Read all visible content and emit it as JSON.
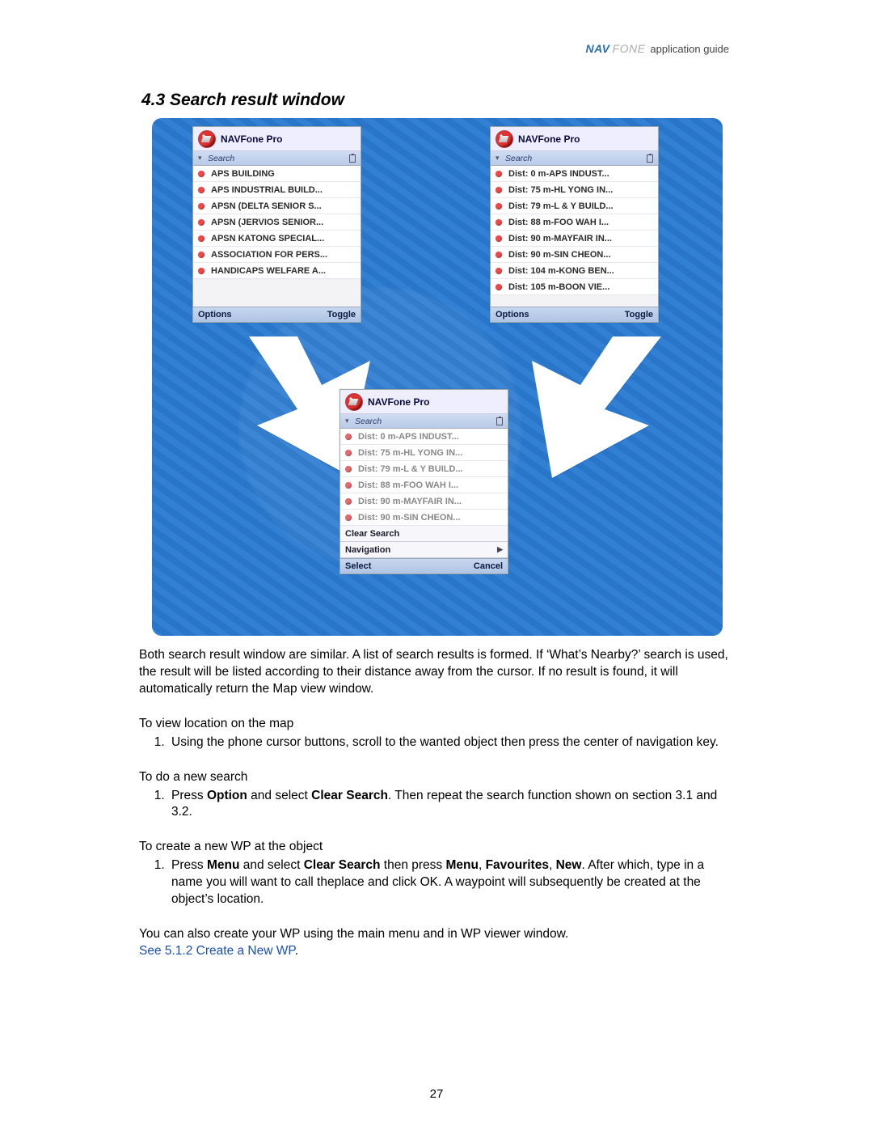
{
  "header": {
    "brand_nav": "NAV",
    "brand_fone": "FONE",
    "subtitle": "application guide"
  },
  "section": {
    "heading": "4.3 Search result window"
  },
  "phones": {
    "p1": {
      "title": "NAVFone Pro",
      "sublabel": "Search",
      "items": [
        "APS BUILDING",
        "APS INDUSTRIAL BUILD...",
        "APSN (DELTA SENIOR S...",
        "APSN (JERVIOS SENIOR...",
        "APSN KATONG SPECIAL...",
        "ASSOCIATION FOR PERS...",
        "HANDICAPS WELFARE A..."
      ],
      "soft_left": "Options",
      "soft_right": "Toggle"
    },
    "p2": {
      "title": "NAVFone Pro",
      "sublabel": "Search",
      "items": [
        "Dist: 0 m-APS INDUST...",
        "Dist: 75 m-HL YONG IN...",
        "Dist: 79 m-L & Y BUILD...",
        "Dist: 88 m-FOO WAH I...",
        "Dist: 90 m-MAYFAIR IN...",
        "Dist: 90 m-SIN CHEON...",
        "Dist: 104 m-KONG BEN...",
        "Dist: 105 m-BOON VIE..."
      ],
      "soft_left": "Options",
      "soft_right": "Toggle"
    },
    "p3": {
      "title": "NAVFone Pro",
      "sublabel": "Search",
      "items": [
        "Dist: 0 m-APS INDUST...",
        "Dist: 75 m-HL YONG IN...",
        "Dist: 79 m-L & Y BUILD...",
        "Dist: 88 m-FOO WAH I...",
        "Dist: 90 m-MAYFAIR IN...",
        "Dist: 90 m-SIN CHEON..."
      ],
      "menu": [
        "Clear Search",
        "Navigation"
      ],
      "soft_left": "Select",
      "soft_right": "Cancel"
    }
  },
  "body": {
    "para1": "Both search result window are similar. A list of search results is formed. If ‘What’s Nearby?’ search is used, the result will be listed according to their distance away from the cursor. If no result is found, it will automatically return the Map view window.",
    "sub1": "To view location on the map",
    "li1": "Using the phone cursor buttons, scroll to the wanted object then press the center of navigation key.",
    "sub2": "To do a new search",
    "li2_pre": "Press ",
    "li2_b1": "Option",
    "li2_mid": " and select ",
    "li2_b2": "Clear Search",
    "li2_post": ". Then repeat the search function shown on section 3.1 and 3.2.",
    "sub3": "To create a new WP at the object",
    "li3_pre": "Press ",
    "li3_b1": "Menu",
    "li3_m1": " and select ",
    "li3_b2": "Clear Search",
    "li3_m2": " then press ",
    "li3_b3": "Menu",
    "li3_c1": ", ",
    "li3_b4": "Favourites",
    "li3_c2": ", ",
    "li3_b5": "New",
    "li3_post": ". After which, type in a name you will want to call theplace and click OK. A waypoint will subsequently be created at the object’s location.",
    "para2_a": "You can also create your WP using the main menu and in WP viewer window. ",
    "para2_link": "See 5.1.2 Create a New WP",
    "para2_b": "."
  },
  "page_number": "27"
}
